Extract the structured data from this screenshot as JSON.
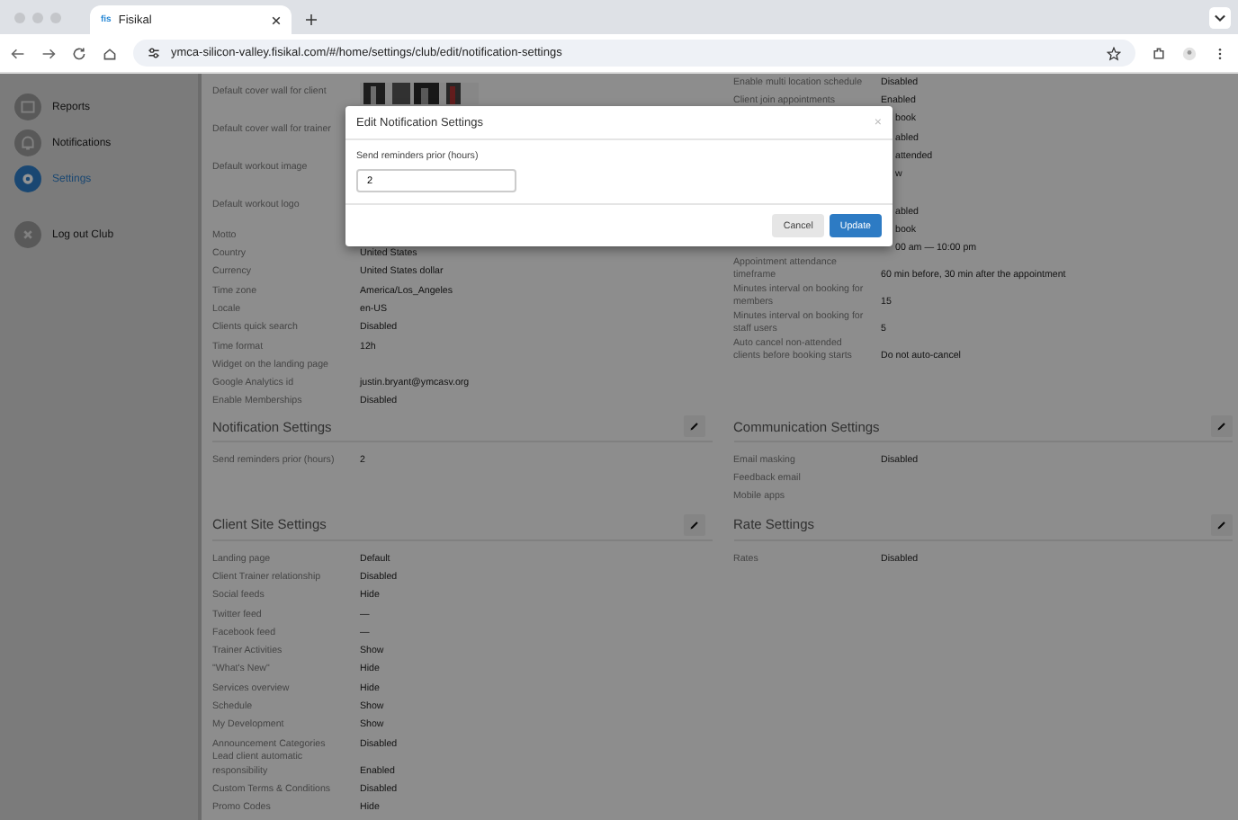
{
  "browser": {
    "tab_icon": "fis",
    "tab_title": "Fisikal",
    "url": "ymca-silicon-valley.fisikal.com/#/home/settings/club/edit/notification-settings"
  },
  "sidebar": [
    {
      "kind": "reports",
      "label": "Reports",
      "selected": false
    },
    {
      "kind": "notifications",
      "label": "Notifications",
      "selected": false
    },
    {
      "kind": "settings",
      "label": "Settings",
      "selected": true
    },
    {
      "kind": "logout",
      "label": "Log out Club",
      "selected": false
    }
  ],
  "general_left": [
    {
      "kind": "picture",
      "label": "Default cover wall for client"
    },
    {
      "kind": "tall",
      "label": "Default cover wall for trainer"
    },
    {
      "kind": "tall",
      "label": "Default workout image"
    },
    {
      "kind": "tall",
      "label": "Default workout logo"
    },
    {
      "kind": "text",
      "label": "Motto"
    },
    {
      "kind": "text",
      "label": "Country",
      "value": "United States"
    },
    {
      "kind": "text",
      "label": "Currency",
      "value": "United States dollar"
    },
    {
      "kind": "text",
      "label": "Time zone",
      "value": "America/Los_Angeles"
    },
    {
      "kind": "text",
      "label": "Locale",
      "value": "en-US"
    },
    {
      "kind": "text",
      "label": "Clients quick search",
      "value": "Disabled"
    },
    {
      "kind": "text",
      "label": "Time format",
      "value": "12h"
    },
    {
      "kind": "text",
      "label": "Widget on the landing page"
    },
    {
      "kind": "text",
      "label": "Google Analytics id",
      "value": "justin.bryant@ymcasv.org"
    },
    {
      "kind": "text",
      "label": "Enable Memberships",
      "value": "Disabled"
    }
  ],
  "general_right": [
    {
      "kind": "text",
      "label": "Enable multi location schedule",
      "value": "Disabled"
    },
    {
      "kind": "text",
      "label": "Client join appointments",
      "value": "Enabled"
    },
    {
      "kind": "partial",
      "value": "book"
    },
    {
      "kind": "partial",
      "value": "abled"
    },
    {
      "kind": "partial",
      "value": "attended"
    },
    {
      "kind": "partial",
      "value": "w"
    },
    {
      "kind": "partial"
    },
    {
      "kind": "partial",
      "value": "abled"
    },
    {
      "kind": "partial",
      "value": "book"
    },
    {
      "kind": "partial",
      "value": "00 am — 10:00 pm"
    },
    {
      "kind": "text",
      "label": "Appointment attendance timeframe",
      "value": "60 min before, 30 min after the appointment"
    },
    {
      "kind": "text",
      "label": "Minutes interval on booking for members",
      "value": "15"
    },
    {
      "kind": "text",
      "label": "Minutes interval on booking for staff users",
      "value": "5"
    },
    {
      "kind": "text",
      "label": "Auto cancel non-attended clients before booking starts",
      "value": "Do not auto-cancel"
    }
  ],
  "section_rows": [
    [
      {
        "title": "Notification Settings",
        "rows": [
          {
            "label": "Send reminders prior (hours)",
            "value": "2"
          }
        ]
      },
      {
        "title": "Communication Settings",
        "rows": [
          {
            "label": "Email masking",
            "value": "Disabled"
          },
          {
            "label": "Feedback email"
          },
          {
            "label": "Mobile apps"
          }
        ]
      }
    ],
    [
      {
        "title": "Client Site Settings",
        "rows": [
          {
            "label": "Landing page",
            "value": "Default"
          },
          {
            "label": "Client Trainer relationship",
            "value": "Disabled"
          },
          {
            "label": "Social feeds",
            "value": "Hide"
          },
          {
            "label": "Twitter feed",
            "value": "—"
          },
          {
            "label": "Facebook feed",
            "value": "—"
          },
          {
            "label": "Trainer Activities",
            "value": "Show"
          },
          {
            "label": "\"What's New\"",
            "value": "Hide"
          },
          {
            "label": "Services overview",
            "value": "Hide"
          },
          {
            "label": "Schedule",
            "value": "Show"
          },
          {
            "label": "My Development",
            "value": "Show"
          },
          {
            "label": "Announcement Categories",
            "value": "Disabled"
          },
          {
            "label": "Lead client automatic responsibility",
            "value": "Enabled"
          },
          {
            "label": "Custom Terms & Conditions",
            "value": "Disabled"
          },
          {
            "label": "Promo Codes",
            "value": "Hide"
          }
        ]
      },
      {
        "title": "Rate Settings",
        "rows": [
          {
            "label": "Rates",
            "value": "Disabled"
          }
        ]
      }
    ]
  ],
  "modal": {
    "title": "Edit Notification Settings",
    "close": "×",
    "field_label": "Send reminders prior (hours)",
    "field_value": "2",
    "buttons": [
      {
        "kind": "secondary",
        "label": "Cancel"
      },
      {
        "kind": "primary",
        "label": "Update"
      }
    ]
  }
}
